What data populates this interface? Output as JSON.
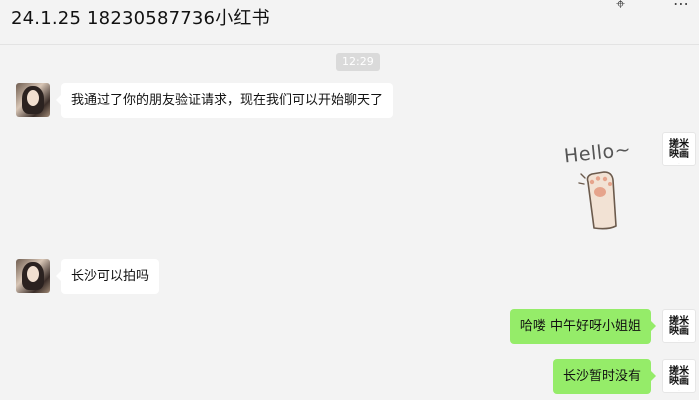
{
  "header": {
    "title": "24.1.25 18230587736小红书",
    "icons": [
      "pin-icon",
      "more-icon"
    ]
  },
  "timestamp": "12:29",
  "contact_avatar": {
    "icon": "contact-avatar-photo"
  },
  "self_avatar": {
    "line1": "搓米",
    "line2": "映画"
  },
  "messages": [
    {
      "side": "left",
      "text": "我通过了你的朋友验证请求，现在我们可以开始聊天了"
    },
    {
      "side": "right",
      "type": "sticker",
      "text": "Hello~"
    },
    {
      "side": "left",
      "text": "长沙可以拍吗"
    },
    {
      "side": "right",
      "text": "哈喽 中午好呀小姐姐"
    },
    {
      "side": "right",
      "text": "长沙暂时没有"
    }
  ],
  "colors": {
    "background": "#f3f3f3",
    "self_bubble": "#95ec69",
    "other_bubble": "#ffffff"
  }
}
